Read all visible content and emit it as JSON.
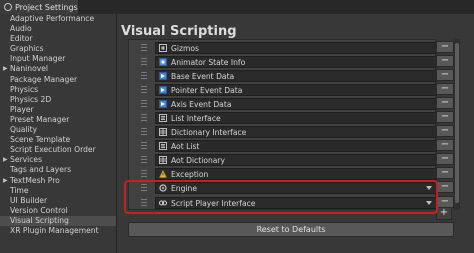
{
  "window": {
    "tab_title": "Project Settings"
  },
  "sidebar": {
    "items": [
      {
        "label": "Adaptive Performance",
        "expandable": false
      },
      {
        "label": "Audio",
        "expandable": false
      },
      {
        "label": "Editor",
        "expandable": false
      },
      {
        "label": "Graphics",
        "expandable": false
      },
      {
        "label": "Input Manager",
        "expandable": false
      },
      {
        "label": "Naninovel",
        "expandable": true
      },
      {
        "label": "Package Manager",
        "expandable": false
      },
      {
        "label": "Physics",
        "expandable": false
      },
      {
        "label": "Physics 2D",
        "expandable": false
      },
      {
        "label": "Player",
        "expandable": false
      },
      {
        "label": "Preset Manager",
        "expandable": false
      },
      {
        "label": "Quality",
        "expandable": false
      },
      {
        "label": "Scene Template",
        "expandable": false
      },
      {
        "label": "Script Execution Order",
        "expandable": false
      },
      {
        "label": "Services",
        "expandable": true
      },
      {
        "label": "Tags and Layers",
        "expandable": false
      },
      {
        "label": "TextMesh Pro",
        "expandable": true
      },
      {
        "label": "Time",
        "expandable": false
      },
      {
        "label": "UI Builder",
        "expandable": false
      },
      {
        "label": "Version Control",
        "expandable": false
      },
      {
        "label": "Visual Scripting",
        "expandable": false,
        "selected": true
      },
      {
        "label": "XR Plugin Management",
        "expandable": false
      }
    ]
  },
  "main": {
    "heading": "Visual Scripting",
    "type_rows": [
      {
        "label": "Gizmos",
        "icon": "gizmos-icon",
        "has_dropdown": false
      },
      {
        "label": "Animator State Info",
        "icon": "animator-icon",
        "has_dropdown": false
      },
      {
        "label": "Base Event Data",
        "icon": "event-data-icon",
        "has_dropdown": false
      },
      {
        "label": "Pointer Event Data",
        "icon": "event-data-icon",
        "has_dropdown": false
      },
      {
        "label": "Axis Event Data",
        "icon": "event-data-icon",
        "has_dropdown": false
      },
      {
        "label": "List Interface",
        "icon": "list-icon",
        "has_dropdown": false
      },
      {
        "label": "Dictionary Interface",
        "icon": "dictionary-icon",
        "has_dropdown": false
      },
      {
        "label": "Aot List",
        "icon": "list-icon",
        "has_dropdown": false
      },
      {
        "label": "Aot Dictionary",
        "icon": "dictionary-icon",
        "has_dropdown": false
      },
      {
        "label": "Exception",
        "icon": "exception-icon",
        "has_dropdown": false
      },
      {
        "label": "Engine",
        "icon": "engine-icon",
        "has_dropdown": true
      },
      {
        "label": "Script Player Interface",
        "icon": "script-player-icon",
        "has_dropdown": true
      }
    ],
    "remove_symbol": "−",
    "add_symbol": "+",
    "reset_button": "Reset to Defaults"
  },
  "colors": {
    "highlight": "#c8201e",
    "selected_bg": "#4d4d4d",
    "field_bg": "#2a2a2a"
  }
}
